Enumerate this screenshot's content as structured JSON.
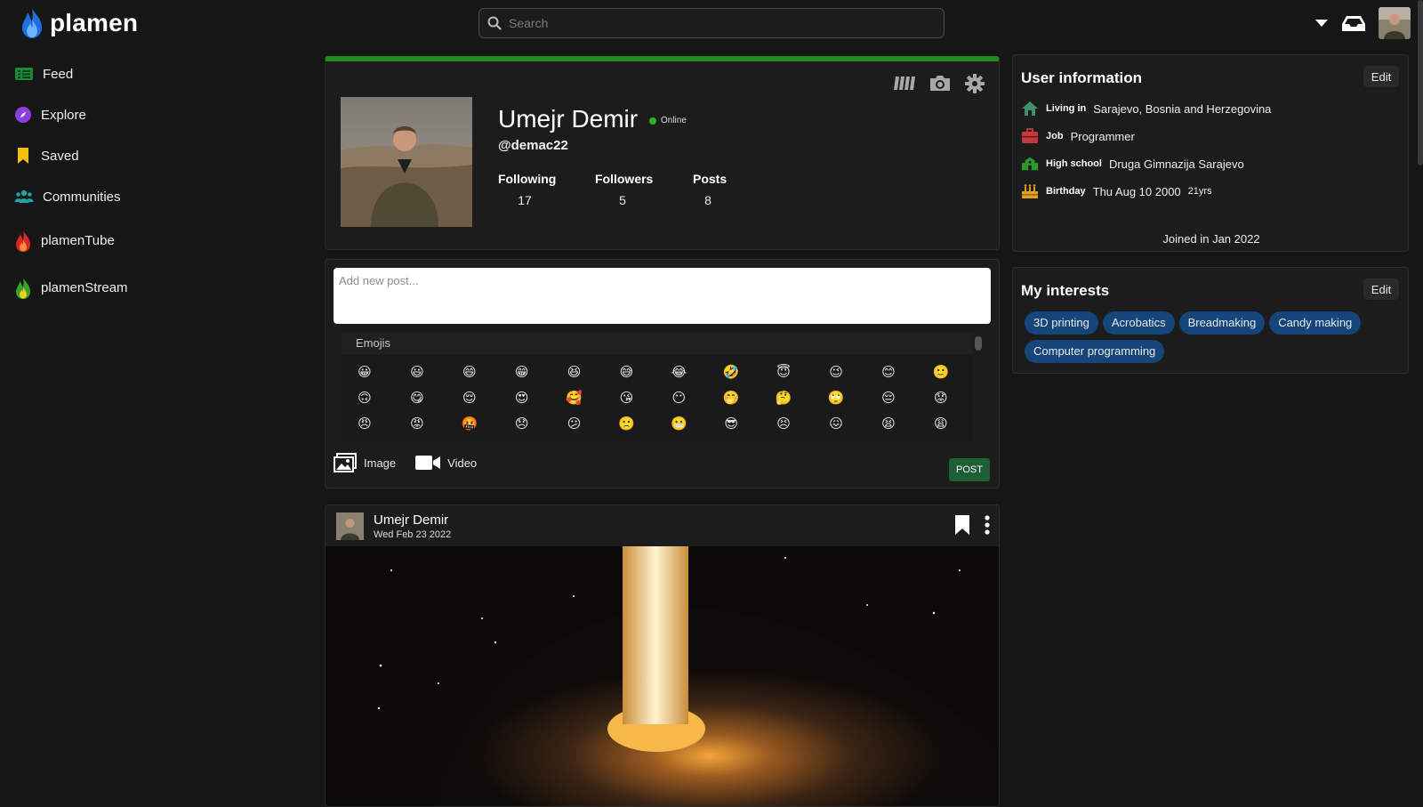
{
  "app": {
    "name": "plamen"
  },
  "search": {
    "placeholder": "Search"
  },
  "sidebar": {
    "items": [
      {
        "label": "Feed",
        "icon": "feed-icon"
      },
      {
        "label": "Explore",
        "icon": "compass-icon"
      },
      {
        "label": "Saved",
        "icon": "bookmark-icon"
      },
      {
        "label": "Communities",
        "icon": "users-icon"
      },
      {
        "label": "plamenTube",
        "icon": "flame-red-icon"
      },
      {
        "label": "plamenStream",
        "icon": "flame-green-icon"
      }
    ]
  },
  "profile": {
    "name": "Umejr Demir",
    "status": "Online",
    "handle": "@demac22",
    "stats": {
      "following_label": "Following",
      "following": "17",
      "followers_label": "Followers",
      "followers": "5",
      "posts_label": "Posts",
      "posts": "8"
    }
  },
  "composer": {
    "placeholder": "Add new post...",
    "emojis_title": "Emojis",
    "emojis": [
      "😀",
      "😃",
      "😄",
      "😁",
      "😆",
      "😅",
      "😂",
      "🤣",
      "😇",
      "😉",
      "😊",
      "🙂",
      "🙃",
      "😋",
      "😌",
      "😍",
      "🥰",
      "😘",
      "😶",
      "🤭",
      "🤔",
      "🙄",
      "😔",
      "😟",
      "😠",
      "😡",
      "🤬",
      "😞",
      "😕",
      "🙁",
      "😬",
      "😎",
      "😣",
      "😖",
      "😫",
      "😩"
    ],
    "image_label": "Image",
    "video_label": "Video",
    "post_label": "POST"
  },
  "post": {
    "author": "Umejr Demir",
    "date": "Wed Feb 23 2022"
  },
  "user_info": {
    "title": "User information",
    "edit_label": "Edit",
    "living_label": "Living in",
    "living": "Sarajevo, Bosnia and Herzegovina",
    "job_label": "Job",
    "job": "Programmer",
    "school_label": "High school",
    "school": "Druga Gimnazija Sarajevo",
    "birthday_label": "Birthday",
    "birthday": "Thu Aug 10 2000",
    "age": "21yrs",
    "joined": "Joined in Jan 2022"
  },
  "interests": {
    "title": "My interests",
    "edit_label": "Edit",
    "items": [
      "3D printing",
      "Acrobatics",
      "Breadmaking",
      "Candy making",
      "Computer programming"
    ]
  },
  "colors": {
    "accent_green": "#1f8a1f",
    "chip_blue": "#16457b",
    "post_button": "#1d5e36"
  }
}
